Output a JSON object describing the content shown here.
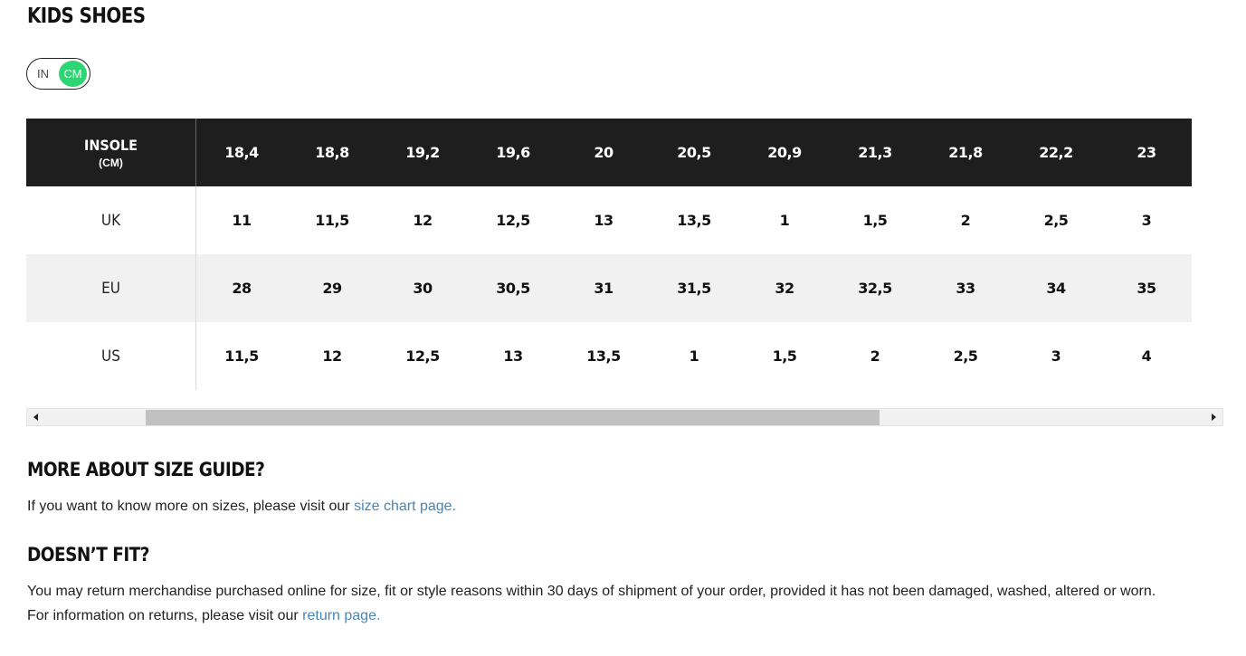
{
  "title": "KIDS SHOES",
  "unit_toggle": {
    "options": [
      "IN",
      "CM"
    ],
    "selected": "CM"
  },
  "table": {
    "header_label": "INSOLE",
    "header_unit": "(CM)",
    "insole_cm": [
      "18,4",
      "18,8",
      "19,2",
      "19,6",
      "20",
      "20,5",
      "20,9",
      "21,3",
      "21,8",
      "22,2",
      "23"
    ],
    "rows": [
      {
        "label": "UK",
        "values": [
          "11",
          "11,5",
          "12",
          "12,5",
          "13",
          "13,5",
          "1",
          "1,5",
          "2",
          "2,5",
          "3"
        ]
      },
      {
        "label": "EU",
        "values": [
          "28",
          "29",
          "30",
          "30,5",
          "31",
          "31,5",
          "32",
          "32,5",
          "33",
          "34",
          "35"
        ]
      },
      {
        "label": "US",
        "values": [
          "11,5",
          "12",
          "12,5",
          "13",
          "13,5",
          "1",
          "1,5",
          "2",
          "2,5",
          "3",
          "4"
        ]
      }
    ]
  },
  "more_about": {
    "heading": "MORE ABOUT SIZE GUIDE?",
    "text": "If you want to know more on sizes, please visit our ",
    "link_text": "size chart page."
  },
  "doesnt_fit": {
    "heading": "DOESN’T FIT?",
    "text_line1": "You may return merchandise purchased online for size, fit or style reasons within 30 days of shipment of your order, provided it has not been damaged, washed, altered or worn.",
    "text_line2": "For information on returns, please visit our ",
    "link_text": "return page."
  }
}
